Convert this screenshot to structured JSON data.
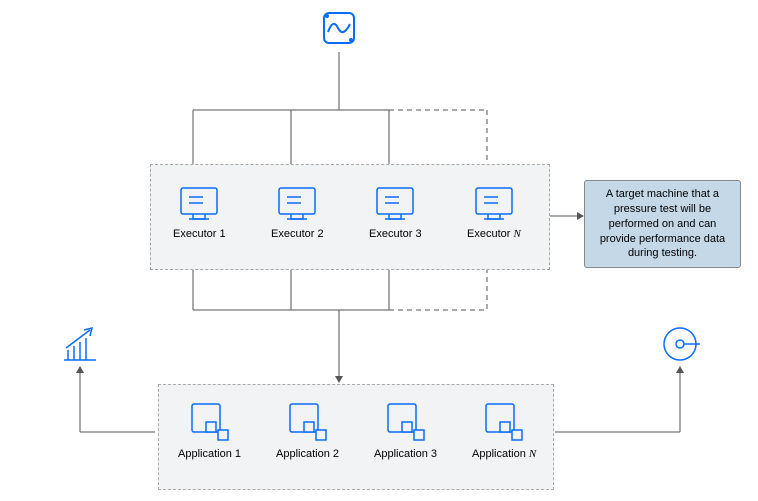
{
  "top_icon": "waveform-chip-icon",
  "executors_group": {
    "items": [
      {
        "label_prefix": "Executor ",
        "label_num": "1"
      },
      {
        "label_prefix": "Executor ",
        "label_num": "2"
      },
      {
        "label_prefix": "Executor ",
        "label_num": "3"
      },
      {
        "label_prefix": "Executor ",
        "label_num": "",
        "label_suffix_italic": "N"
      }
    ]
  },
  "applications_group": {
    "items": [
      {
        "label_prefix": "Application ",
        "label_num": "1"
      },
      {
        "label_prefix": "Application ",
        "label_num": "2"
      },
      {
        "label_prefix": "Application ",
        "label_num": "3"
      },
      {
        "label_prefix": "Application ",
        "label_num": "",
        "label_suffix_italic": "N"
      }
    ]
  },
  "callout_text": "A target machine that a pressure test will be performed on and can provide performance data during testing.",
  "left_icon": "growth-chart-icon",
  "right_icon": "gauge-icon"
}
